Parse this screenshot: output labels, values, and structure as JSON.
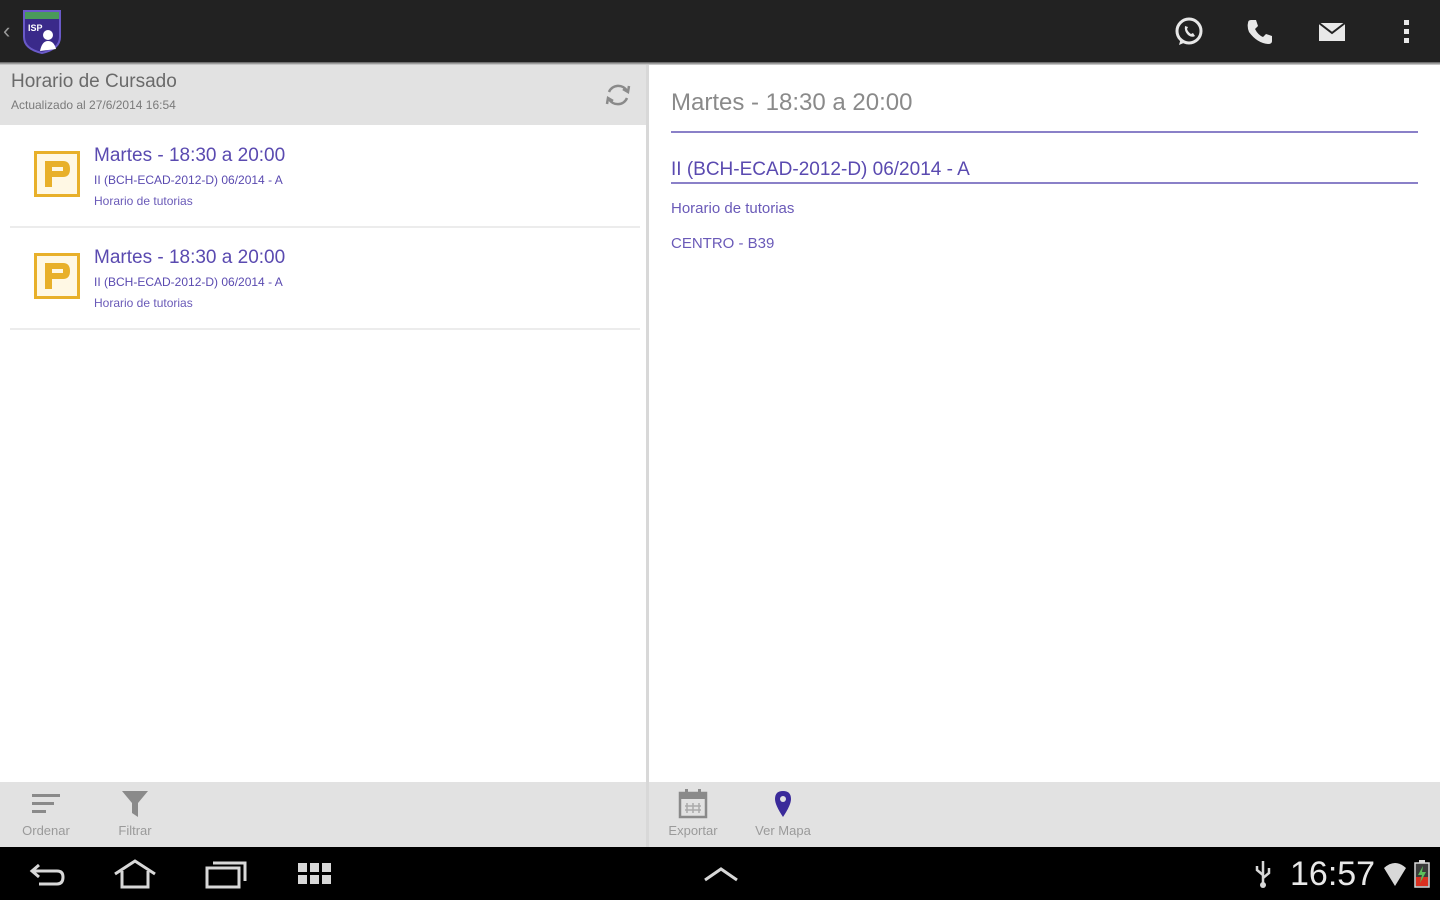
{
  "actionbar": {
    "back_icon": "chevron-left-icon",
    "logo_text": "ISP",
    "actions": [
      "whatsapp-icon",
      "phone-icon",
      "mail-icon",
      "overflow-menu-icon"
    ]
  },
  "list_pane": {
    "title": "Horario de Cursado",
    "updated": "Actualizado al 27/6/2014 16:54",
    "refresh_icon": "refresh-icon",
    "items": [
      {
        "icon": "parking-p-icon",
        "title": "Martes - 18:30 a 20:00",
        "subtitle": "II (BCH-ECAD-2012-D) 06/2014 - A",
        "detail": "Horario de tutorias"
      },
      {
        "icon": "parking-p-icon",
        "title": "Martes - 18:30 a 20:00",
        "subtitle": "II (BCH-ECAD-2012-D) 06/2014 - A",
        "detail": "Horario de tutorias"
      }
    ]
  },
  "detail_pane": {
    "title": "Martes - 18:30 a 20:00",
    "course": "II (BCH-ECAD-2012-D) 06/2014 - A",
    "type": "Horario de tutorias",
    "location": "CENTRO - B39"
  },
  "left_toolbar": {
    "sort_label": "Ordenar",
    "filter_label": "Filtrar"
  },
  "right_toolbar": {
    "export_label": "Exportar",
    "map_label": "Ver Mapa"
  },
  "system_bar": {
    "time": "16:57"
  },
  "colors": {
    "accent": "#5a4ab0",
    "icon_yellow": "#e8b02a",
    "actionbar_bg": "#222222"
  }
}
